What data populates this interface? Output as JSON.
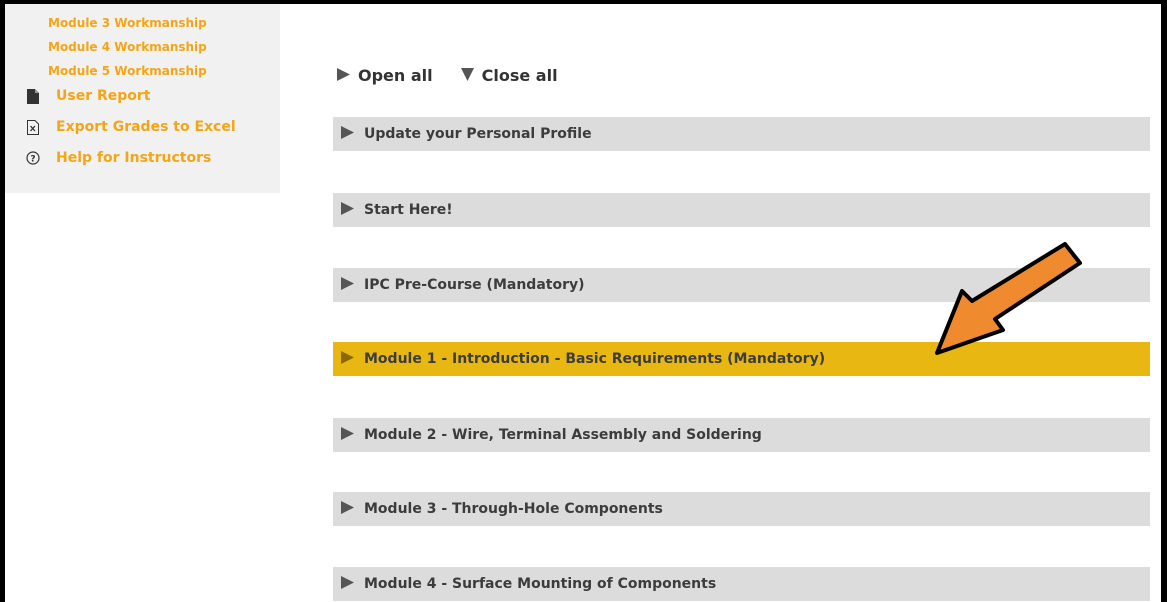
{
  "sidebar": {
    "sub_links": [
      "Module 3 Workmanship",
      "Module 4 Workmanship",
      "Module 5 Workmanship"
    ],
    "links": [
      {
        "label": "User Report",
        "icon": "file-icon"
      },
      {
        "label": "Export Grades to Excel",
        "icon": "excel-file-icon"
      },
      {
        "label": "Help for Instructors",
        "icon": "help-circle-icon"
      }
    ]
  },
  "controls": {
    "open_all": "Open all",
    "close_all": "Close all"
  },
  "sections": [
    "Update your Personal Profile",
    "Start Here!",
    "IPC Pre-Course (Mandatory)",
    "Module 1 - Introduction - Basic Requirements (Mandatory)",
    "Module 2 - Wire, Terminal Assembly and Soldering",
    "Module 3 - Through-Hole Components",
    "Module 4 - Surface Mounting of Components"
  ],
  "highlighted_section": "Module 1 - Introduction - Basic Requirements (Mandatory)",
  "colors": {
    "link": "#f4a516",
    "section_bg": "#dcdcdc",
    "highlight_bg": "#e8b712",
    "annotation_arrow": "#f08a2e"
  }
}
